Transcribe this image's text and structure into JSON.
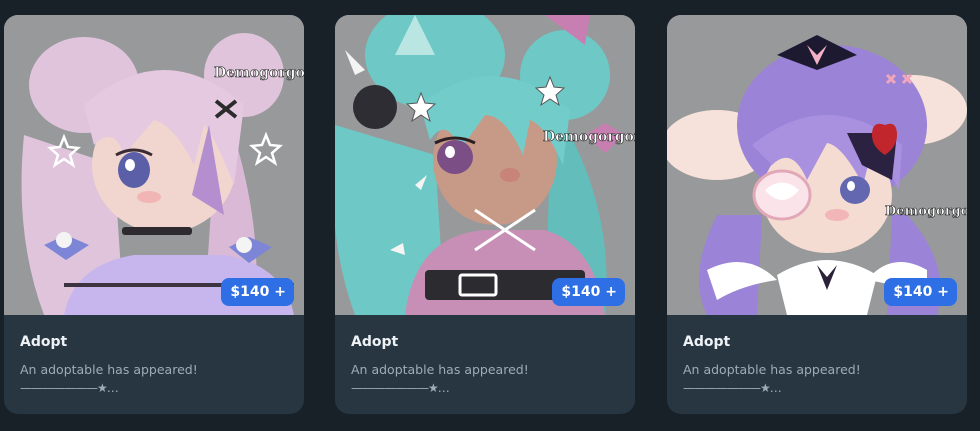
{
  "cards": [
    {
      "price": "$140 +",
      "title": "Adopt",
      "description": "An adoptable has appeared!",
      "decoration": "———————★…",
      "watermark": "Demogorgon",
      "hair_color": "#e0c4dc",
      "accent_color": "#b6a7e6"
    },
    {
      "price": "$140 +",
      "title": "Adopt",
      "description": "An adoptable has appeared!",
      "decoration": "———————★…",
      "watermark": "Demogorgon",
      "hair_color": "#6ec9c6",
      "accent_color": "#c77fb2"
    },
    {
      "price": "$140 +",
      "title": "Adopt",
      "description": "An adoptable has appeared!",
      "decoration": "———————★…",
      "watermark": "Demogorgon",
      "hair_color": "#9b83d8",
      "accent_color": "#f2b4c6"
    }
  ],
  "colors": {
    "page_bg": "#182028",
    "card_bg": "#283642",
    "price_badge": "#2f6fe6"
  }
}
